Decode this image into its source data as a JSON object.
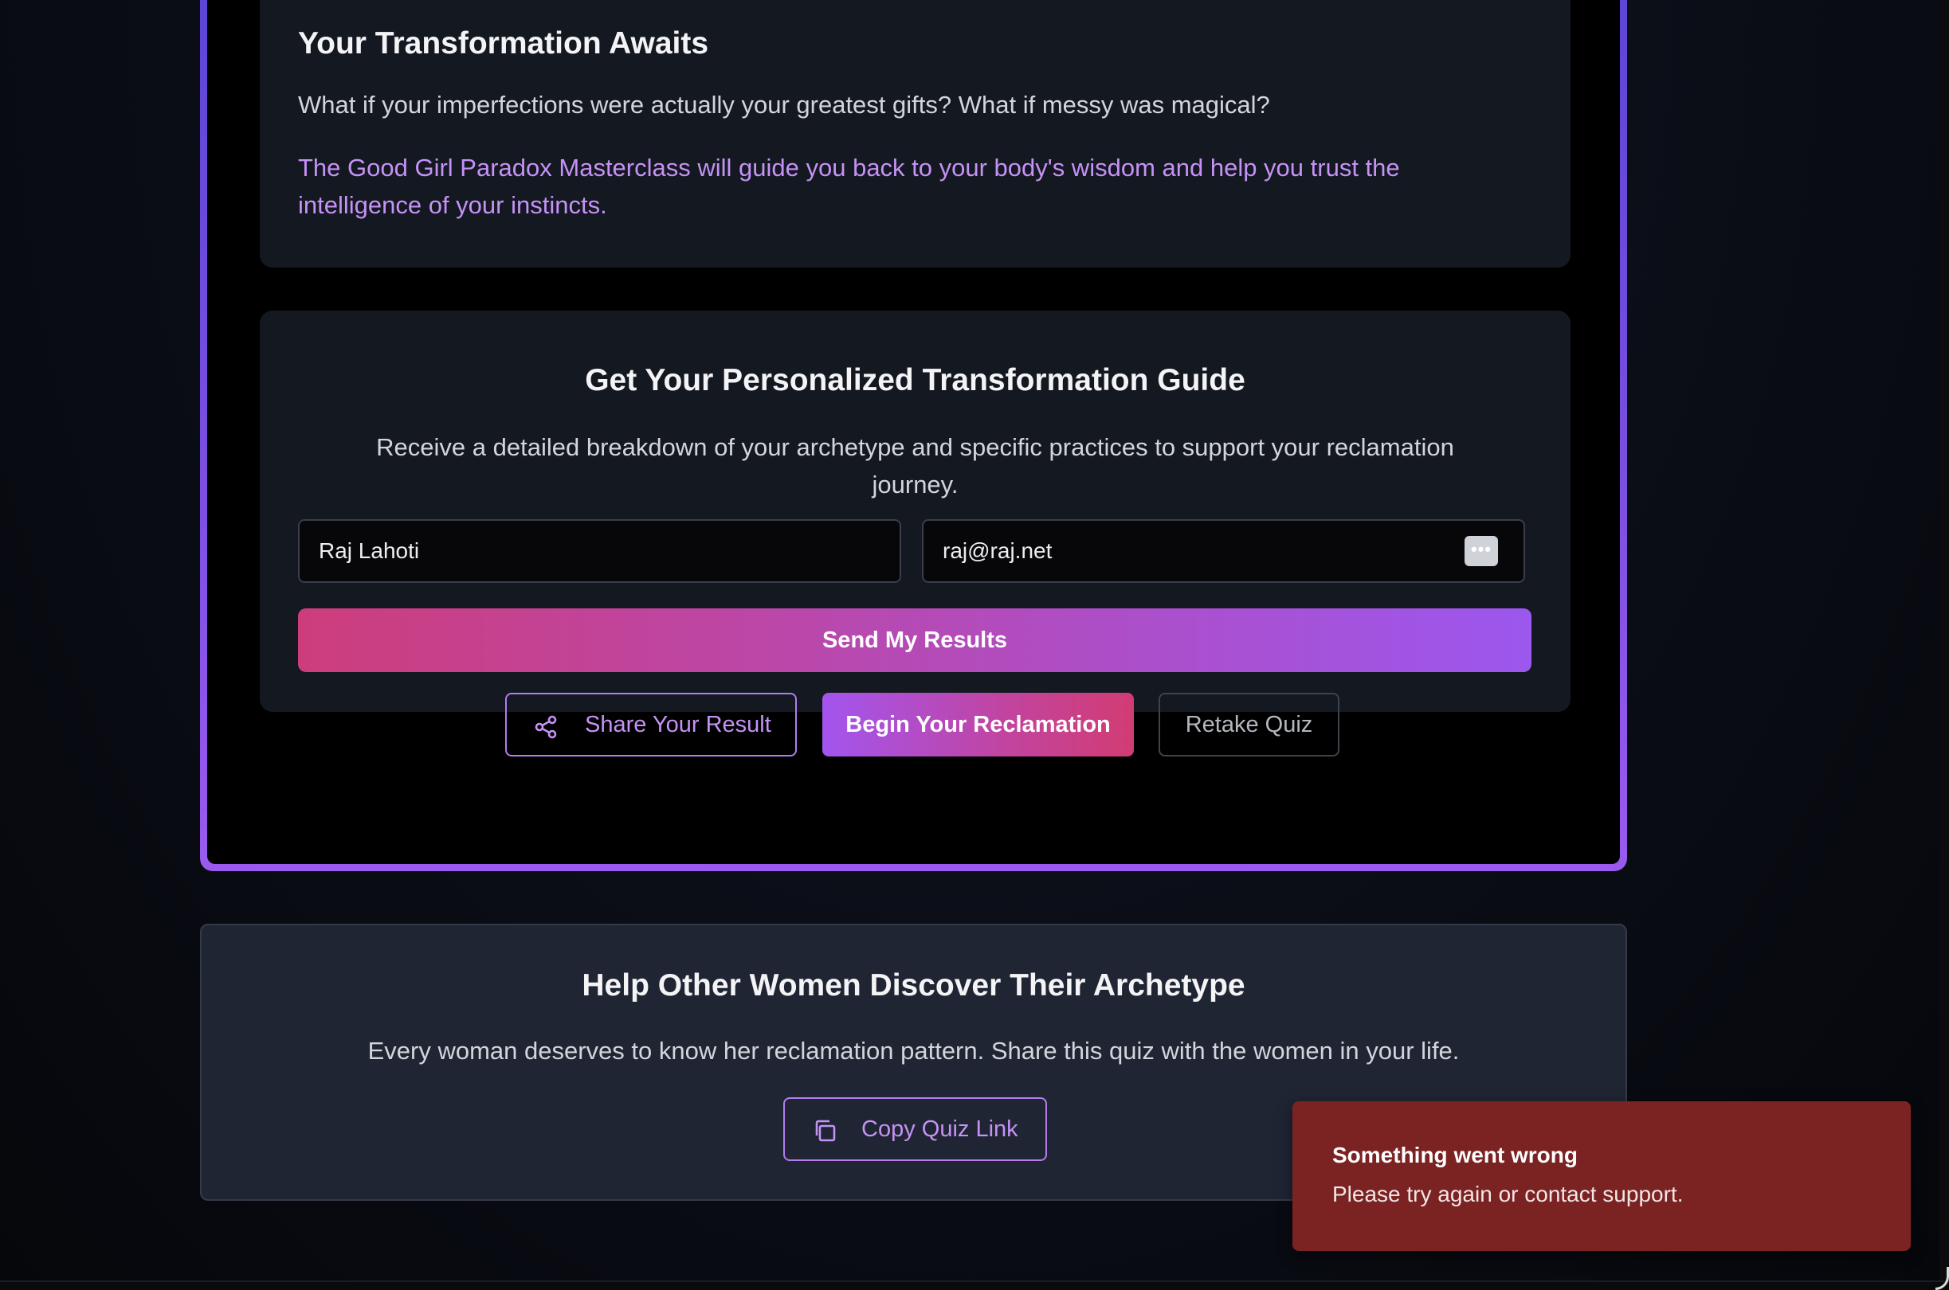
{
  "colors": {
    "accent_purple": "#9c57ee",
    "accent_pink": "#cd3d7c",
    "highlight_text": "#c592f5",
    "error_toast_bg": "#7a2322",
    "panel_bg": "#141821",
    "help_card_bg": "#1f2533"
  },
  "transformation": {
    "title": "Your Transformation Awaits",
    "question": "What if your imperfections were actually your greatest gifts? What if messy was magical?",
    "highlight": "The Good Girl Paradox Masterclass will guide you back to your body's wisdom and help you trust the intelligence of your instincts."
  },
  "guide": {
    "title": "Get Your Personalized Transformation Guide",
    "description": "Receive a detailed breakdown of your archetype and specific practices to support your reclamation journey.",
    "name_value": "Raj Lahoti",
    "email_value": "raj@raj.net",
    "autofill_icon_name": "password-manager-icon",
    "autofill_glyph": "•••",
    "send_label": "Send My Results"
  },
  "actions": {
    "share_label": "Share Your Result",
    "share_icon_name": "share-icon",
    "begin_label": "Begin Your Reclamation",
    "retake_label": "Retake Quiz"
  },
  "help": {
    "title": "Help Other Women Discover Their Archetype",
    "description": "Every woman deserves to know her reclamation pattern. Share this quiz with the women in your life.",
    "copy_label": "Copy Quiz Link",
    "copy_icon_name": "copy-icon"
  },
  "toast": {
    "title": "Something went wrong",
    "message": "Please try again or contact support."
  }
}
